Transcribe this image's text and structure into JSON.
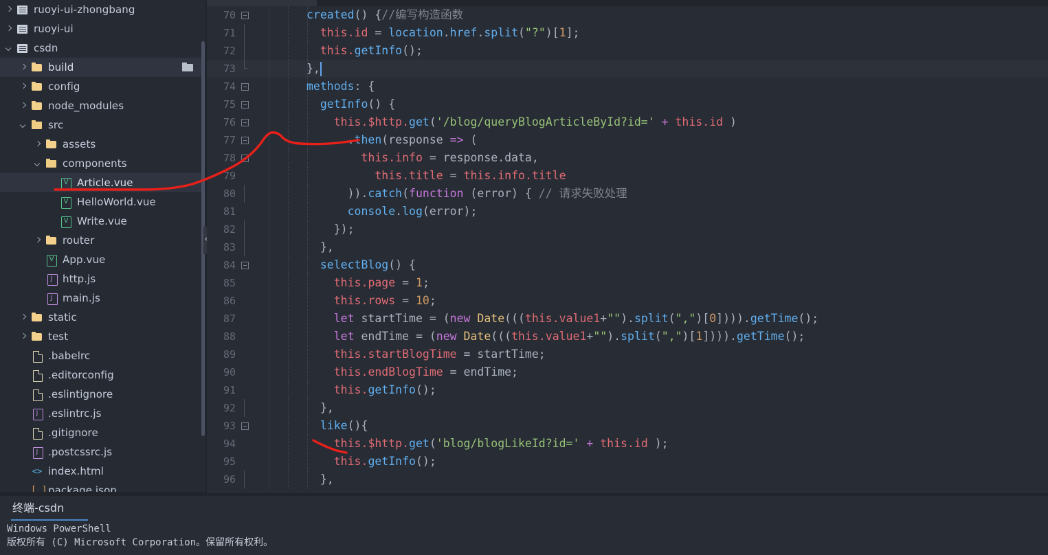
{
  "sidebar": {
    "name": "project-file-tree",
    "items": [
      {
        "label": "ruoyi-ui-zhongbang",
        "icon": "module-icon",
        "arrow": "right",
        "indent": 0,
        "selected": false
      },
      {
        "label": "ruoyi-ui",
        "icon": "module-icon",
        "arrow": "right",
        "indent": 0,
        "selected": false
      },
      {
        "label": "csdn",
        "icon": "module-icon",
        "arrow": "down",
        "indent": 0,
        "selected": false
      },
      {
        "label": "build",
        "icon": "folder-icon",
        "arrow": "right",
        "indent": 1,
        "selected": true,
        "badge": "folder-badge-icon"
      },
      {
        "label": "config",
        "icon": "folder-icon",
        "arrow": "right",
        "indent": 1,
        "selected": false
      },
      {
        "label": "node_modules",
        "icon": "folder-icon",
        "arrow": "right",
        "indent": 1,
        "selected": false
      },
      {
        "label": "src",
        "icon": "folder-open-icon",
        "arrow": "down",
        "indent": 1,
        "selected": false
      },
      {
        "label": "assets",
        "icon": "folder-icon",
        "arrow": "right",
        "indent": 2,
        "selected": false
      },
      {
        "label": "components",
        "icon": "folder-open-icon",
        "arrow": "down",
        "indent": 2,
        "selected": false
      },
      {
        "label": "Article.vue",
        "icon": "vue-file-icon",
        "arrow": "none",
        "indent": 3,
        "selected": true
      },
      {
        "label": "HelloWorld.vue",
        "icon": "vue-file-icon",
        "arrow": "none",
        "indent": 3,
        "selected": false
      },
      {
        "label": "Write.vue",
        "icon": "vue-file-icon",
        "arrow": "none",
        "indent": 3,
        "selected": false
      },
      {
        "label": "router",
        "icon": "folder-icon",
        "arrow": "right",
        "indent": 2,
        "selected": false
      },
      {
        "label": "App.vue",
        "icon": "vue-file-icon",
        "arrow": "none",
        "indent": 2,
        "selected": false
      },
      {
        "label": "http.js",
        "icon": "js-file-icon",
        "arrow": "none",
        "indent": 2,
        "selected": false
      },
      {
        "label": "main.js",
        "icon": "js-file-icon",
        "arrow": "none",
        "indent": 2,
        "selected": false
      },
      {
        "label": "static",
        "icon": "folder-icon",
        "arrow": "right",
        "indent": 1,
        "selected": false
      },
      {
        "label": "test",
        "icon": "folder-icon",
        "arrow": "right",
        "indent": 1,
        "selected": false
      },
      {
        "label": ".babelrc",
        "icon": "text-file-icon",
        "arrow": "none",
        "indent": 1,
        "selected": false
      },
      {
        "label": ".editorconfig",
        "icon": "text-file-icon",
        "arrow": "none",
        "indent": 1,
        "selected": false
      },
      {
        "label": ".eslintignore",
        "icon": "text-file-icon",
        "arrow": "none",
        "indent": 1,
        "selected": false
      },
      {
        "label": ".eslintrc.js",
        "icon": "js-file-icon",
        "arrow": "none",
        "indent": 1,
        "selected": false
      },
      {
        "label": ".gitignore",
        "icon": "text-file-icon",
        "arrow": "none",
        "indent": 1,
        "selected": false
      },
      {
        "label": ".postcssrc.js",
        "icon": "js-file-icon",
        "arrow": "none",
        "indent": 1,
        "selected": false
      },
      {
        "label": "index.html",
        "icon": "html-file-icon",
        "arrow": "none",
        "indent": 1,
        "selected": false
      },
      {
        "label": "package.json",
        "icon": "json-file-icon",
        "arrow": "none",
        "indent": 1,
        "selected": false
      }
    ]
  },
  "editor": {
    "name": "code-editor",
    "first_line_number": 70,
    "cursor_line": 73,
    "lines": [
      {
        "num": "70",
        "fold": "minus",
        "text": "created() {//编写构造函数"
      },
      {
        "num": "71",
        "fold": "bar",
        "text": "  this.id = location.href.split(\"?\")[1];"
      },
      {
        "num": "72",
        "fold": "bar",
        "text": "  this.getInfo();"
      },
      {
        "num": "73",
        "fold": "end",
        "text": "},"
      },
      {
        "num": "74",
        "fold": "minus",
        "text": "methods: {"
      },
      {
        "num": "75",
        "fold": "minus",
        "text": "  getInfo() {"
      },
      {
        "num": "76",
        "fold": "minus",
        "text": "    this.$http.get('/blog/queryBlogArticleById?id=' + this.id )"
      },
      {
        "num": "77",
        "fold": "minus",
        "text": "      .then(response => ("
      },
      {
        "num": "78",
        "fold": "minus",
        "text": "        this.info = response.data,"
      },
      {
        "num": "79",
        "fold": "none",
        "text": "          this.title = this.info.title"
      },
      {
        "num": "80",
        "fold": "bar",
        "text": "      )).catch(function (error) { // 请求失败处理"
      },
      {
        "num": "81",
        "fold": "none",
        "text": "      console.log(error);"
      },
      {
        "num": "82",
        "fold": "bar",
        "text": "    });"
      },
      {
        "num": "83",
        "fold": "bar",
        "text": "  },"
      },
      {
        "num": "84",
        "fold": "minus",
        "text": "  selectBlog() {"
      },
      {
        "num": "85",
        "fold": "none",
        "text": "    this.page = 1;"
      },
      {
        "num": "86",
        "fold": "none",
        "text": "    this.rows = 10;"
      },
      {
        "num": "87",
        "fold": "none",
        "text": "    let startTime = (new Date(((this.value1+\"\").split(\",\")[0]))).getTime();"
      },
      {
        "num": "88",
        "fold": "none",
        "text": "    let endTime = (new Date(((this.value1+\"\").split(\",\")[1]))).getTime();"
      },
      {
        "num": "89",
        "fold": "none",
        "text": "    this.startBlogTime = startTime;"
      },
      {
        "num": "90",
        "fold": "none",
        "text": "    this.endBlogTime = endTime;"
      },
      {
        "num": "91",
        "fold": "none",
        "text": "    this.getInfo();"
      },
      {
        "num": "92",
        "fold": "bar",
        "text": "  },"
      },
      {
        "num": "93",
        "fold": "minus",
        "text": "  like(){"
      },
      {
        "num": "94",
        "fold": "none",
        "text": "    this.$http.get('blog/blogLikeId?id=' + this.id );"
      },
      {
        "num": "95",
        "fold": "none",
        "text": "    this.getInfo();"
      },
      {
        "num": "96",
        "fold": "bar",
        "text": "  },"
      }
    ]
  },
  "terminal": {
    "name": "terminal-panel",
    "tab_label": "终端-csdn",
    "lines": [
      "Windows PowerShell",
      "版权所有 (C) Microsoft Corporation。保留所有权利。"
    ]
  },
  "colors": {
    "sidebar_bg": "#262a33",
    "editor_bg": "#282c34",
    "current_line": "#2c313a",
    "accent_underline": "#4a88c7",
    "annotation_red": "#e8201a",
    "keyword": "#c678dd",
    "function": "#61afef",
    "string": "#98c379",
    "number": "#d19a66",
    "property": "#e06c75",
    "comment": "#7f848e"
  },
  "annotations": {
    "name": "red-ink-marks",
    "marks": [
      {
        "id": "underline-article-vue",
        "desc": "red curve underlining Article.vue and sweeping up to line 77"
      },
      {
        "id": "underline-line-94",
        "desc": "short red stroke before this.$http.get on line 94"
      }
    ]
  }
}
